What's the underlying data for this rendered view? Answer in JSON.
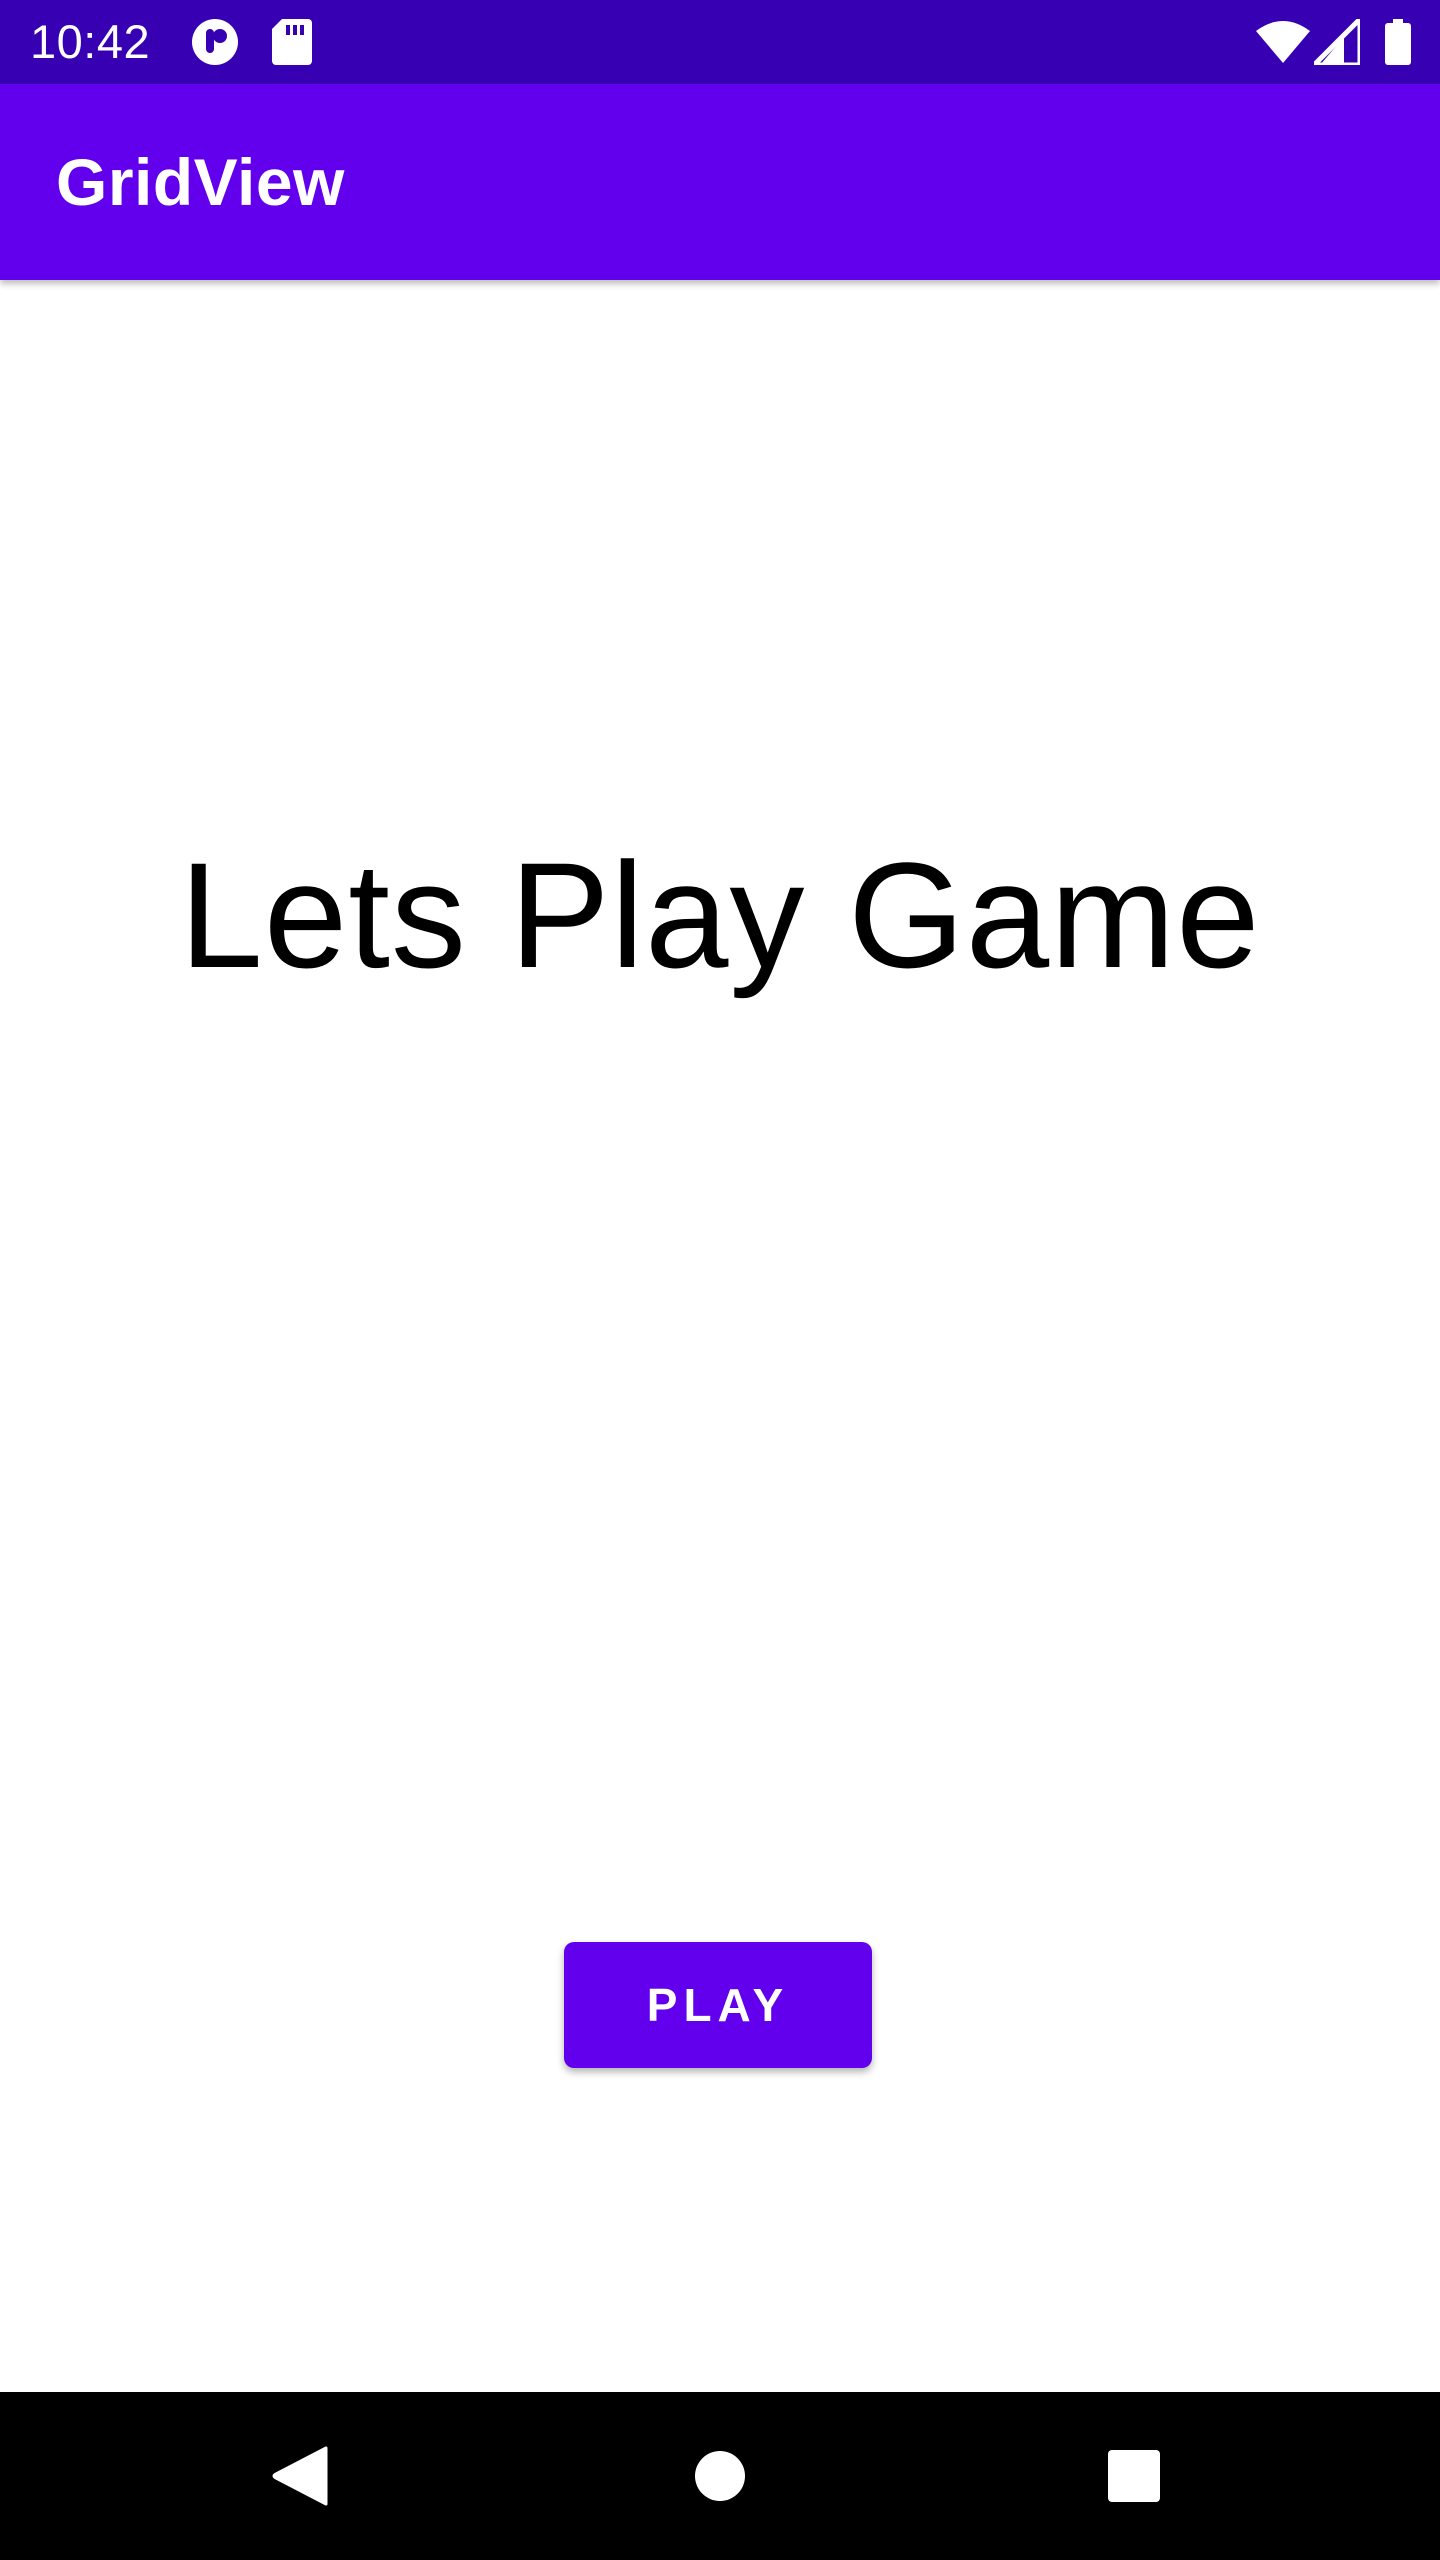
{
  "status_bar": {
    "time": "10:42",
    "background": "#3700b3",
    "icons": [
      "app-notification-icon",
      "sd-card-icon",
      "wifi-icon",
      "cell-signal-icon",
      "battery-icon"
    ]
  },
  "app_bar": {
    "title": "GridView",
    "background": "#6200ee"
  },
  "main": {
    "headline": "Lets Play Game",
    "play_button_label": "PLAY",
    "accent": "#6200ee"
  },
  "nav_bar": {
    "buttons": [
      "back-icon",
      "home-icon",
      "recents-icon"
    ]
  }
}
